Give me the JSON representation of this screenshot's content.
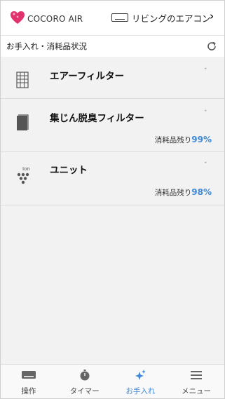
{
  "header": {
    "brand": "COCORO AIR",
    "device_name": "リビングのエアコン",
    "device_chevron": "›",
    "logo_color": "#e0336e"
  },
  "section": {
    "title": "お手入れ・消耗品状況",
    "refresh_icon": "refresh-icon"
  },
  "items": [
    {
      "title": "エアーフィルター",
      "icon": "air-filter-icon",
      "chevron": "ˇ",
      "remaining_label": "",
      "remaining_pct": ""
    },
    {
      "title": "集じん脱臭フィルター",
      "icon": "deodorizing-filter-icon",
      "chevron": "ˇ",
      "remaining_label": "消耗品残り",
      "remaining_pct": "99%"
    },
    {
      "title": "ユニット",
      "icon": "ion-unit-icon",
      "icon_text": "Ion",
      "chevron": "ˇ",
      "remaining_label": "消耗品残り",
      "remaining_pct": "98%"
    }
  ],
  "tabs": [
    {
      "label": "操作",
      "icon": "remote-control-icon"
    },
    {
      "label": "タイマー",
      "icon": "timer-icon"
    },
    {
      "label": "お手入れ",
      "icon": "sparkle-icon",
      "active": true
    },
    {
      "label": "メニュー",
      "icon": "menu-icon"
    }
  ],
  "colors": {
    "accent": "#3f89d8",
    "brand": "#e0336e"
  }
}
